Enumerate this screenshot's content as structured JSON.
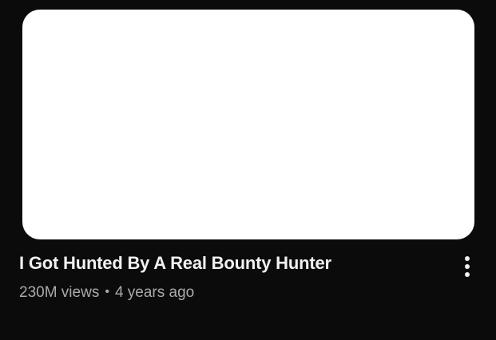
{
  "video": {
    "title": "I Got Hunted By A Real Bounty Hunter",
    "views": "230M views",
    "separator": "•",
    "age": "4 years ago"
  },
  "icons": {
    "more": "more-vert-icon"
  },
  "colors": {
    "background": "#0b0b0b",
    "title": "#f1f1f1",
    "metadata": "#aaaaaa",
    "thumbnail": "#ffffff"
  }
}
